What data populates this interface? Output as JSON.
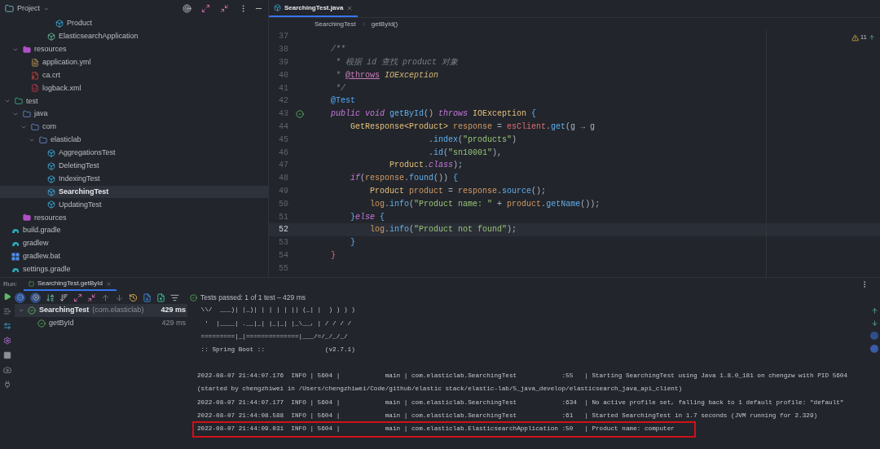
{
  "project_panel": {
    "title": "Project",
    "tree": [
      {
        "children": [
          {
            "children": [
              {
                "children": [
                  {
                    "children": [
                      {
                        "children": [
                          {
                            "children": [
                              {
                                "label": "Product",
                                "kind": "class",
                                "selected": false
                              }
                            ]
                          },
                          {
                            "label": "ElasticsearchApplication",
                            "kind": "app",
                            "selected": false
                          }
                        ]
                      }
                    ]
                  }
                ]
              },
              {
                "label": "resources",
                "kind": "resources",
                "expanded": true,
                "selected": false,
                "children": [
                  {
                    "label": "application.yml",
                    "kind": "yml",
                    "selected": false
                  },
                  {
                    "label": "ca.crt",
                    "kind": "crt",
                    "selected": false
                  },
                  {
                    "label": "logback.xml",
                    "kind": "xml",
                    "selected": false
                  }
                ]
              }
            ]
          },
          {
            "label": "test",
            "kind": "test-root",
            "expanded": true,
            "selected": false,
            "children": [
              {
                "label": "java",
                "kind": "package",
                "expanded": true,
                "selected": false,
                "children": [
                  {
                    "label": "com",
                    "kind": "package",
                    "expanded": true,
                    "selected": false,
                    "children": [
                      {
                        "label": "elasticlab",
                        "kind": "package",
                        "expanded": true,
                        "selected": false,
                        "children": [
                          {
                            "label": "AggregationsTest",
                            "kind": "class",
                            "selected": false
                          },
                          {
                            "label": "DeletingTest",
                            "kind": "class",
                            "selected": false
                          },
                          {
                            "label": "IndexingTest",
                            "kind": "class",
                            "selected": false
                          },
                          {
                            "label": "SearchingTest",
                            "kind": "class",
                            "selected": true
                          },
                          {
                            "label": "UpdatingTest",
                            "kind": "class",
                            "selected": false
                          }
                        ]
                      }
                    ]
                  }
                ]
              },
              {
                "label": "resources",
                "kind": "resources",
                "selected": false
              }
            ]
          }
        ]
      },
      {
        "label": "build.gradle",
        "kind": "gradle",
        "selected": false
      },
      {
        "label": "gradlew",
        "kind": "gradle",
        "selected": false
      },
      {
        "label": "gradlew.bat",
        "kind": "bat",
        "selected": false
      },
      {
        "label": "settings.gradle",
        "kind": "gradle",
        "selected": false
      }
    ]
  },
  "editor": {
    "tab": {
      "label": "SearchingTest.java",
      "selected": true
    },
    "breadcrumb": [
      "SearchingTest",
      "getById()"
    ],
    "warnings": "11",
    "lines": [
      {
        "number": "37",
        "current": false
      },
      {
        "number": "38",
        "current": false,
        "tokens": [
          {
            "text": "    /**",
            "kind": "comment"
          }
        ]
      },
      {
        "number": "39",
        "current": false,
        "tokens": [
          {
            "text": "     * 根据 id 查找 product 对象",
            "kind": "comment"
          }
        ]
      },
      {
        "number": "40",
        "current": false,
        "tokens": [
          {
            "text": "     * ",
            "kind": "comment"
          },
          {
            "text": "@throws",
            "kind": "doctag"
          },
          {
            "text": " IOException",
            "kind": "doctype"
          }
        ]
      },
      {
        "number": "41",
        "current": false,
        "tokens": [
          {
            "text": "     */",
            "kind": "comment"
          }
        ]
      },
      {
        "number": "42",
        "current": false,
        "tokens": [
          {
            "text": "    @Test",
            "kind": "annotation"
          }
        ]
      },
      {
        "number": "43",
        "current": false,
        "test_passed": true,
        "tokens": [
          {
            "text": "    public void ",
            "kind": "keyword"
          },
          {
            "text": "getById",
            "kind": "method"
          },
          {
            "text": "() ",
            "kind": "punct"
          },
          {
            "text": "throws ",
            "kind": "keyword"
          },
          {
            "text": "IOException ",
            "kind": "type"
          },
          {
            "text": "{",
            "kind": "brace"
          }
        ]
      },
      {
        "number": "44",
        "current": false,
        "tokens": [
          {
            "text": "        GetResponse<Product> ",
            "kind": "type"
          },
          {
            "text": "response",
            "kind": "var"
          },
          {
            "text": " = ",
            "kind": "punct"
          },
          {
            "text": "esClient",
            "kind": "field"
          },
          {
            "text": ".",
            "kind": "punct"
          },
          {
            "text": "get",
            "kind": "method"
          },
          {
            "text": "(g → g",
            "kind": "punct"
          }
        ]
      },
      {
        "number": "45",
        "current": false,
        "tokens": [
          {
            "text": "                        .",
            "kind": "punct"
          },
          {
            "text": "index",
            "kind": "method"
          },
          {
            "text": "(",
            "kind": "punct"
          },
          {
            "text": "\"products\"",
            "kind": "string"
          },
          {
            "text": ")",
            "kind": "punct"
          }
        ]
      },
      {
        "number": "46",
        "current": false,
        "tokens": [
          {
            "text": "                        .",
            "kind": "punct"
          },
          {
            "text": "id",
            "kind": "method"
          },
          {
            "text": "(",
            "kind": "punct"
          },
          {
            "text": "\"sn10001\"",
            "kind": "string"
          },
          {
            "text": "),",
            "kind": "punct"
          }
        ]
      },
      {
        "number": "47",
        "current": false,
        "tokens": [
          {
            "text": "                Product",
            "kind": "type"
          },
          {
            "text": ".",
            "kind": "punct"
          },
          {
            "text": "class",
            "kind": "keyword"
          },
          {
            "text": ");",
            "kind": "punct"
          }
        ]
      },
      {
        "number": "48",
        "current": false,
        "tokens": [
          {
            "text": "        if",
            "kind": "keyword"
          },
          {
            "text": "(",
            "kind": "punct"
          },
          {
            "text": "response",
            "kind": "var"
          },
          {
            "text": ".",
            "kind": "punct"
          },
          {
            "text": "found",
            "kind": "method"
          },
          {
            "text": "()) ",
            "kind": "punct"
          },
          {
            "text": "{",
            "kind": "brace"
          }
        ]
      },
      {
        "number": "49",
        "current": false,
        "tokens": [
          {
            "text": "            Product ",
            "kind": "type"
          },
          {
            "text": "product",
            "kind": "var"
          },
          {
            "text": " = ",
            "kind": "punct"
          },
          {
            "text": "response",
            "kind": "var"
          },
          {
            "text": ".",
            "kind": "punct"
          },
          {
            "text": "source",
            "kind": "method"
          },
          {
            "text": "();",
            "kind": "punct"
          }
        ]
      },
      {
        "number": "50",
        "current": false,
        "tokens": [
          {
            "text": "            log",
            "kind": "var"
          },
          {
            "text": ".",
            "kind": "punct"
          },
          {
            "text": "info",
            "kind": "method"
          },
          {
            "text": "(",
            "kind": "punct"
          },
          {
            "text": "\"Product name: \"",
            "kind": "string"
          },
          {
            "text": " + ",
            "kind": "punct"
          },
          {
            "text": "product",
            "kind": "var"
          },
          {
            "text": ".",
            "kind": "punct"
          },
          {
            "text": "getName",
            "kind": "method"
          },
          {
            "text": "());",
            "kind": "punct"
          }
        ]
      },
      {
        "number": "51",
        "current": false,
        "tokens": [
          {
            "text": "        }",
            "kind": "brace"
          },
          {
            "text": "else",
            "kind": "keyword"
          },
          {
            "text": " {",
            "kind": "brace"
          }
        ]
      },
      {
        "number": "52",
        "current": true,
        "tokens": [
          {
            "text": "            log",
            "kind": "var"
          },
          {
            "text": ".",
            "kind": "punct"
          },
          {
            "text": "info",
            "kind": "method"
          },
          {
            "text": "(",
            "kind": "punct"
          },
          {
            "text": "\"Product not found\"",
            "kind": "string"
          },
          {
            "text": ");",
            "kind": "punct"
          }
        ]
      },
      {
        "number": "53",
        "current": false,
        "tokens": [
          {
            "text": "        }",
            "kind": "brace"
          }
        ]
      },
      {
        "number": "54",
        "current": false,
        "tokens": [
          {
            "text": "    }",
            "kind": "brace2"
          }
        ]
      },
      {
        "number": "55",
        "current": false
      }
    ]
  },
  "run_panel": {
    "label": "Run:",
    "tab": {
      "label": "SearchingTest.getById",
      "selected": true
    },
    "status": "Tests passed: 1 of 1 test – 429 ms",
    "tests": [
      {
        "label": "SearchingTest",
        "package": "(com.elasticlab)",
        "time": "429 ms",
        "selected": true,
        "expanded": true,
        "passed": true,
        "children": [
          {
            "label": "getById",
            "time": "429 ms",
            "selected": false,
            "passed": true
          }
        ]
      }
    ],
    "console": [
      {
        "lines": [
          {
            "text": " \\\\/  ___)| |_)| | | | | || (_| |  ) ) ) )",
            "highlighted": false
          },
          {
            "text": "  '  |____| .__|_| |_|_| |_\\__, | / / / /",
            "highlighted": false
          },
          {
            "text": " =========|_|==============|___/=/_/_/_/",
            "highlighted": false
          },
          {
            "text": " :: Spring Boot ::                (v2.7.1)",
            "highlighted": false
          }
        ]
      },
      {
        "lines": [
          {
            "text": "2022-08-07 21:44:07.176  INFO | 5604 |            main | com.elasticlab.SearchingTest            :55   | Starting SearchingTest using Java 1.8.0_181 on chengzw with PID 5604",
            "highlighted": false
          },
          {
            "text": "(started by chengzhiwei in /Users/chengzhiwei/Code/github/elastic stack/elastic-lab/5_java_develop/elasticsearch_java_api_client)",
            "highlighted": false
          },
          {
            "text": "2022-08-07 21:44:07.177  INFO | 5604 |            main | com.elasticlab.SearchingTest            :634  | No active profile set, falling back to 1 default profile: \"default\"",
            "highlighted": false
          },
          {
            "text": "2022-08-07 21:44:08.588  INFO | 5604 |            main | com.elasticlab.SearchingTest            :61   | Started SearchingTest in 1.7 seconds (JVM running for 2.329)",
            "highlighted": false
          },
          {
            "text": "2022-08-07 21:44:09.031  INFO | 5604 |            main | com.elasticlab.ElasticsearchApplication :50   | Product name: computer",
            "highlighted": true
          }
        ]
      }
    ]
  }
}
